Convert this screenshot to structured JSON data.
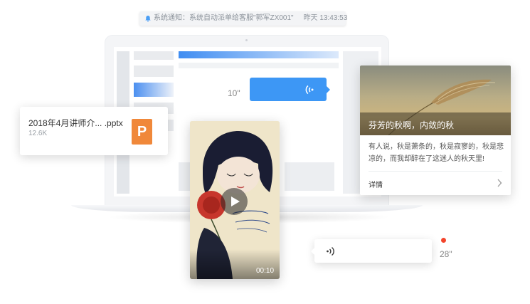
{
  "notification": {
    "text": "系统通知：系统自动派单给客服\"郭军ZX001\"",
    "timestamp": "昨天  13:43:53",
    "icon": "bell-icon"
  },
  "file_card": {
    "name": "2018年4月讲师介... .pptx",
    "size": "12.6K",
    "icon_letter": "P",
    "icon_color": "#f0883a"
  },
  "voice_sent": {
    "duration": "10\"",
    "color": "#3d97f5"
  },
  "voice_received": {
    "duration": "28\"",
    "unread_color": "#f3442b"
  },
  "article": {
    "title": "芬芳的秋啊，内敛的秋",
    "body": "有人说，秋是萧条的，秋是寂寥的，秋是悲凉的，而我却醉在了这迷人的秋天里!",
    "link": "详情"
  },
  "video": {
    "duration": "00:10"
  }
}
